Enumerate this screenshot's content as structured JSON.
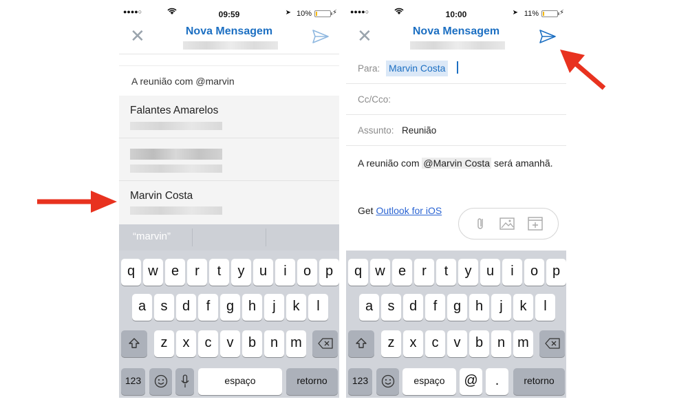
{
  "left": {
    "status": {
      "time": "09:59",
      "battery": "10%",
      "battery_level": 0.1
    },
    "nav": {
      "title": "Nova Mensagem"
    },
    "compose_text": "A reunião com @marvin",
    "suggestions": [
      {
        "name": "Falantes Amarelos"
      },
      {
        "name": ""
      },
      {
        "name": "Marvin Costa"
      }
    ],
    "predictive": {
      "word": "“marvin”"
    },
    "keyboard": {
      "row1": [
        "q",
        "w",
        "e",
        "r",
        "t",
        "y",
        "u",
        "i",
        "o",
        "p"
      ],
      "row2": [
        "a",
        "s",
        "d",
        "f",
        "g",
        "h",
        "j",
        "k",
        "l"
      ],
      "row3": [
        "z",
        "x",
        "c",
        "v",
        "b",
        "n",
        "m"
      ],
      "numbers": "123",
      "space": "espaço",
      "return": "retorno"
    }
  },
  "right": {
    "status": {
      "time": "10:00",
      "battery": "11%",
      "battery_level": 0.11
    },
    "nav": {
      "title": "Nova Mensagem"
    },
    "to_label": "Para:",
    "to_value": "Marvin Costa",
    "cc_label": "Cc/Cco:",
    "subject_label": "Assunto:",
    "subject_value": "Reunião",
    "body_pre": "A reunião com ",
    "body_mention": "@Marvin Costa",
    "body_post": " será amanhã.",
    "signature_prefix": "Get ",
    "signature_link": "Outlook for iOS",
    "keyboard": {
      "row1": [
        "q",
        "w",
        "e",
        "r",
        "t",
        "y",
        "u",
        "i",
        "o",
        "p"
      ],
      "row2": [
        "a",
        "s",
        "d",
        "f",
        "g",
        "h",
        "j",
        "k",
        "l"
      ],
      "row3": [
        "z",
        "x",
        "c",
        "v",
        "b",
        "n",
        "m"
      ],
      "numbers": "123",
      "space": "espaço",
      "at": "@",
      "dot": ".",
      "return": "retorno"
    }
  },
  "colors": {
    "accent": "#1c6fc2",
    "arrow": "#e8321f",
    "keyboard": "#d1d4da"
  }
}
